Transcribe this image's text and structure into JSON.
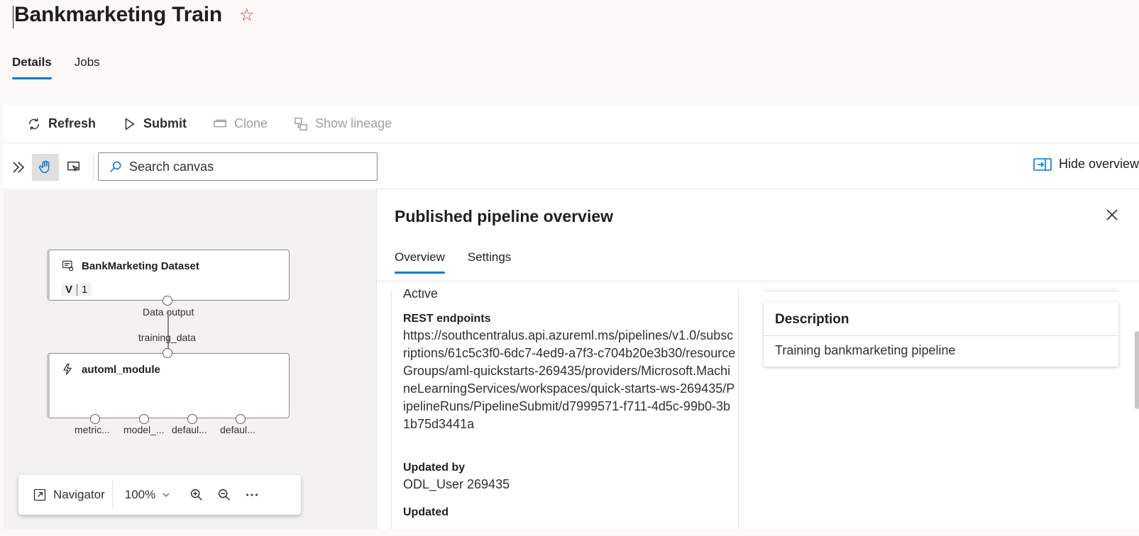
{
  "header": {
    "title": "Bankmarketing Train"
  },
  "tabs": [
    {
      "label": "Details"
    },
    {
      "label": "Jobs"
    }
  ],
  "toolbar": {
    "refresh": "Refresh",
    "submit": "Submit",
    "clone": "Clone",
    "lineage": "Show lineage"
  },
  "canvas_bar": {
    "search_placeholder": "Search canvas",
    "hide_overview": "Hide overview"
  },
  "canvas": {
    "dataset_node": {
      "title": "BankMarketing Dataset",
      "version_prefix": "V",
      "version": "1",
      "output_label": "Data output"
    },
    "module_node": {
      "title": "automl_module",
      "input_label": "training_data",
      "outputs": [
        "metric...",
        "model_...",
        "defaul...",
        "defaul..."
      ]
    }
  },
  "navigator": {
    "label": "Navigator",
    "zoom": "100%"
  },
  "panel": {
    "title": "Published pipeline overview",
    "tabs": [
      {
        "label": "Overview"
      },
      {
        "label": "Settings"
      }
    ],
    "status_value": "Active",
    "rest_label": "REST endpoints",
    "rest_value": "https://southcentralus.api.azureml.ms/pipelines/v1.0/subscriptions/61c5c3f0-6dc7-4ed9-a7f3-c704b20e3b30/resourceGroups/aml-quickstarts-269435/providers/Microsoft.MachineLearningServices/workspaces/quick-starts-ws-269435/PipelineRuns/PipelineSubmit/d7999571-f711-4d5c-99b0-3b1b75d3441a",
    "updated_by_label": "Updated by",
    "updated_by_value": "ODL_User 269435",
    "updated_label": "Updated",
    "description": {
      "title": "Description",
      "value": "Training bankmarketing pipeline"
    }
  },
  "colors": {
    "accent": "#0078d4",
    "favorite": "#d13438"
  }
}
